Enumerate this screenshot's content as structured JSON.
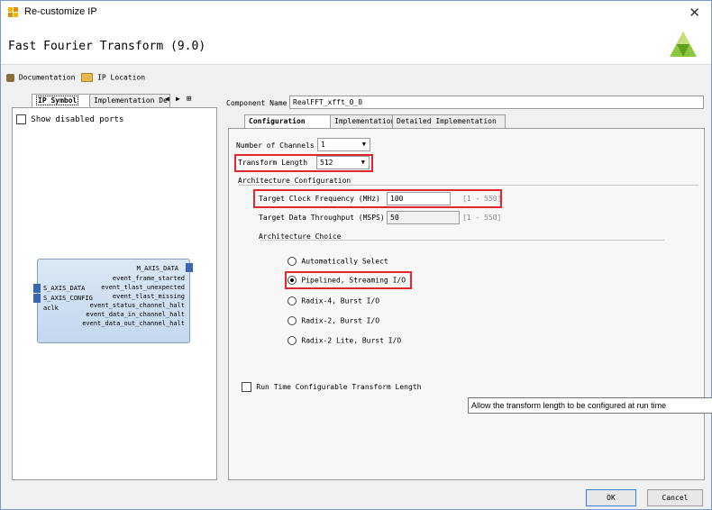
{
  "window": {
    "title": "Re-customize IP"
  },
  "header": {
    "title": "Fast Fourier Transform (9.0)"
  },
  "toolbar": {
    "documentation": "Documentation",
    "ip_location": "IP Location"
  },
  "left_panel": {
    "tabs": [
      "IP Symbol",
      "Implementation De"
    ],
    "show_disabled_ports": "Show disabled ports",
    "symbol": {
      "right_top": "M_AXIS_DATA",
      "right_ports": [
        "event_frame_started",
        "event_tlast_unexpected",
        "event_tlast_missing",
        "event_status_channel_halt",
        "event_data_in_channel_halt",
        "event_data_out_channel_halt"
      ],
      "left_ports": [
        "S_AXIS_DATA",
        "S_AXIS_CONFIG",
        "aclk"
      ]
    }
  },
  "component": {
    "label": "Component Name",
    "value": "RealFFT_xfft_0_0"
  },
  "tabs": [
    "Configuration",
    "Implementation",
    "Detailed Implementation"
  ],
  "config": {
    "channels_label": "Number of Channels",
    "channels_value": "1",
    "transform_length_label": "Transform Length",
    "transform_length_value": "512",
    "arch_config_title": "Architecture Configuration",
    "clock_label": "Target Clock Frequency (MHz)",
    "clock_value": "100",
    "clock_range": "[1 - 550]",
    "throughput_label": "Target Data Throughput (MSPS)",
    "throughput_value": "50",
    "throughput_range": "[1 - 550]",
    "arch_choice_title": "Architecture Choice",
    "options": [
      "Automatically Select",
      "Pipelined, Streaming I/O",
      "Radix-4, Burst I/O",
      "Radix-2, Burst I/O",
      "Radix-2 Lite, Burst I/O"
    ],
    "selected_option": "Pipelined, Streaming I/O",
    "runtime_label": "Run Time Configurable Transform Length"
  },
  "tooltip": "Allow the transform length to be configured at run time",
  "buttons": {
    "ok": "OK",
    "cancel": "Cancel"
  },
  "colors": {
    "highlight": "#e0282c",
    "symbol_fill": "#c3d7ee",
    "logo": "#8cc63f"
  }
}
